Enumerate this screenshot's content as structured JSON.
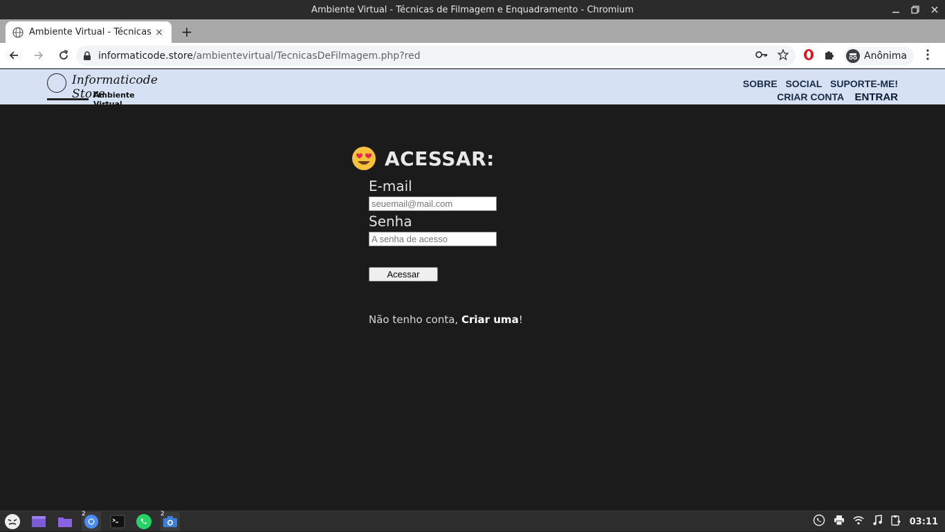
{
  "window": {
    "title": "Ambiente Virtual - Técnicas de Filmagem e Enquadramento - Chromium"
  },
  "tab": {
    "title": "Ambiente Virtual - Técnicas de",
    "close": "×",
    "new_tab": "+"
  },
  "address": {
    "host": "informaticode.store",
    "path": "/ambientevirtual/TecnicasDeFilmagem.php?red"
  },
  "profile": {
    "label": "Anônima"
  },
  "site": {
    "logo_main": "Informaticode Store",
    "logo_sub": "Ambiente Virtual",
    "nav": {
      "sobre": "SOBRE",
      "social": "SOCIAL",
      "suporte": "SUPORTE-ME!",
      "criar_conta": "CRIAR CONTA",
      "entrar": "ENTRAR"
    }
  },
  "login": {
    "heading": "ACESSAR:",
    "email_label": "E-mail",
    "email_placeholder": "seuemail@mail.com",
    "senha_label": "Senha",
    "senha_placeholder": "A senha de acesso",
    "submit_label": "Acessar",
    "no_account_text": "Não tenho conta, ",
    "create_link": "Criar uma",
    "exclaim": "!"
  },
  "taskbar": {
    "chromium_badge": "2",
    "camera_badge": "2",
    "clock": "03:11"
  },
  "colors": {
    "header_bg": "#d6e2f3",
    "page_bg": "#1b1b1b",
    "taskbar_bg": "#2d2d2d"
  }
}
